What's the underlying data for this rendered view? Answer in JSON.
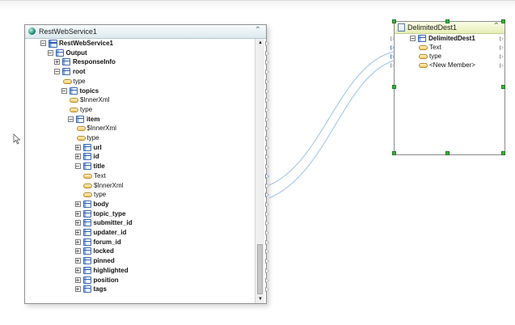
{
  "source_node": {
    "title": "RestWebService1",
    "collapse_icon": "double-chevron-up-icon",
    "tree": [
      {
        "label": "RestWebService1",
        "depth": 0,
        "expander": "-",
        "icon": "table-big",
        "bold": true
      },
      {
        "label": "Output",
        "depth": 1,
        "expander": "-",
        "icon": "table",
        "bold": true
      },
      {
        "label": "ResponseInfo",
        "depth": 2,
        "expander": "+",
        "icon": "table",
        "bold": true
      },
      {
        "label": "root",
        "depth": 2,
        "expander": "-",
        "icon": "table",
        "bold": true
      },
      {
        "label": "type",
        "depth": 3,
        "expander": "",
        "icon": "field",
        "bold": false
      },
      {
        "label": "topics",
        "depth": 3,
        "expander": "-",
        "icon": "table",
        "bold": true
      },
      {
        "label": "$InnerXml",
        "depth": 4,
        "expander": "",
        "icon": "field",
        "bold": false
      },
      {
        "label": "type",
        "depth": 4,
        "expander": "",
        "icon": "field",
        "bold": false
      },
      {
        "label": "item",
        "depth": 4,
        "expander": "-",
        "icon": "table",
        "bold": true
      },
      {
        "label": "$InnerXml",
        "depth": 5,
        "expander": "",
        "icon": "field",
        "bold": false
      },
      {
        "label": "type",
        "depth": 5,
        "expander": "",
        "icon": "field",
        "bold": false
      },
      {
        "label": "url",
        "depth": 5,
        "expander": "+",
        "icon": "table",
        "bold": true
      },
      {
        "label": "id",
        "depth": 5,
        "expander": "+",
        "icon": "table",
        "bold": true
      },
      {
        "label": "title",
        "depth": 5,
        "expander": "-",
        "icon": "table",
        "bold": true
      },
      {
        "label": "Text",
        "depth": 6,
        "expander": "",
        "icon": "field",
        "bold": false
      },
      {
        "label": "$InnerXml",
        "depth": 6,
        "expander": "",
        "icon": "field",
        "bold": false
      },
      {
        "label": "type",
        "depth": 6,
        "expander": "",
        "icon": "field",
        "bold": false
      },
      {
        "label": "body",
        "depth": 5,
        "expander": "+",
        "icon": "table",
        "bold": true
      },
      {
        "label": "topic_type",
        "depth": 5,
        "expander": "+",
        "icon": "table",
        "bold": true
      },
      {
        "label": "submitter_id",
        "depth": 5,
        "expander": "+",
        "icon": "table",
        "bold": true
      },
      {
        "label": "updater_id",
        "depth": 5,
        "expander": "+",
        "icon": "table",
        "bold": true
      },
      {
        "label": "forum_id",
        "depth": 5,
        "expander": "+",
        "icon": "table",
        "bold": true
      },
      {
        "label": "locked",
        "depth": 5,
        "expander": "+",
        "icon": "table",
        "bold": true
      },
      {
        "label": "pinned",
        "depth": 5,
        "expander": "+",
        "icon": "table",
        "bold": true
      },
      {
        "label": "highlighted",
        "depth": 5,
        "expander": "+",
        "icon": "table",
        "bold": true
      },
      {
        "label": "position",
        "depth": 5,
        "expander": "+",
        "icon": "table",
        "bold": true
      },
      {
        "label": "tags",
        "depth": 5,
        "expander": "+",
        "icon": "table",
        "bold": true
      }
    ]
  },
  "dest_node": {
    "title": "DelimitedDest1",
    "collapse_icon": "double-chevron-up-icon",
    "tree": [
      {
        "label": "DelimitedDest1",
        "depth": 0,
        "expander": "-",
        "icon": "table",
        "bold": true
      },
      {
        "label": "Text",
        "depth": 1,
        "expander": "",
        "icon": "field",
        "bold": false
      },
      {
        "label": "type",
        "depth": 1,
        "expander": "",
        "icon": "field",
        "bold": false
      },
      {
        "label": "<New Member>",
        "depth": 1,
        "expander": "",
        "icon": "field",
        "bold": false
      }
    ]
  },
  "connections": [
    {
      "from": "Text",
      "to": "Text"
    },
    {
      "from": "type",
      "to": "type"
    }
  ],
  "colors": {
    "source_header": "#dde9ee",
    "dest_header": "#e6efb4",
    "wire": "#9fc3e8",
    "selection_handle": "#3fae3f"
  }
}
